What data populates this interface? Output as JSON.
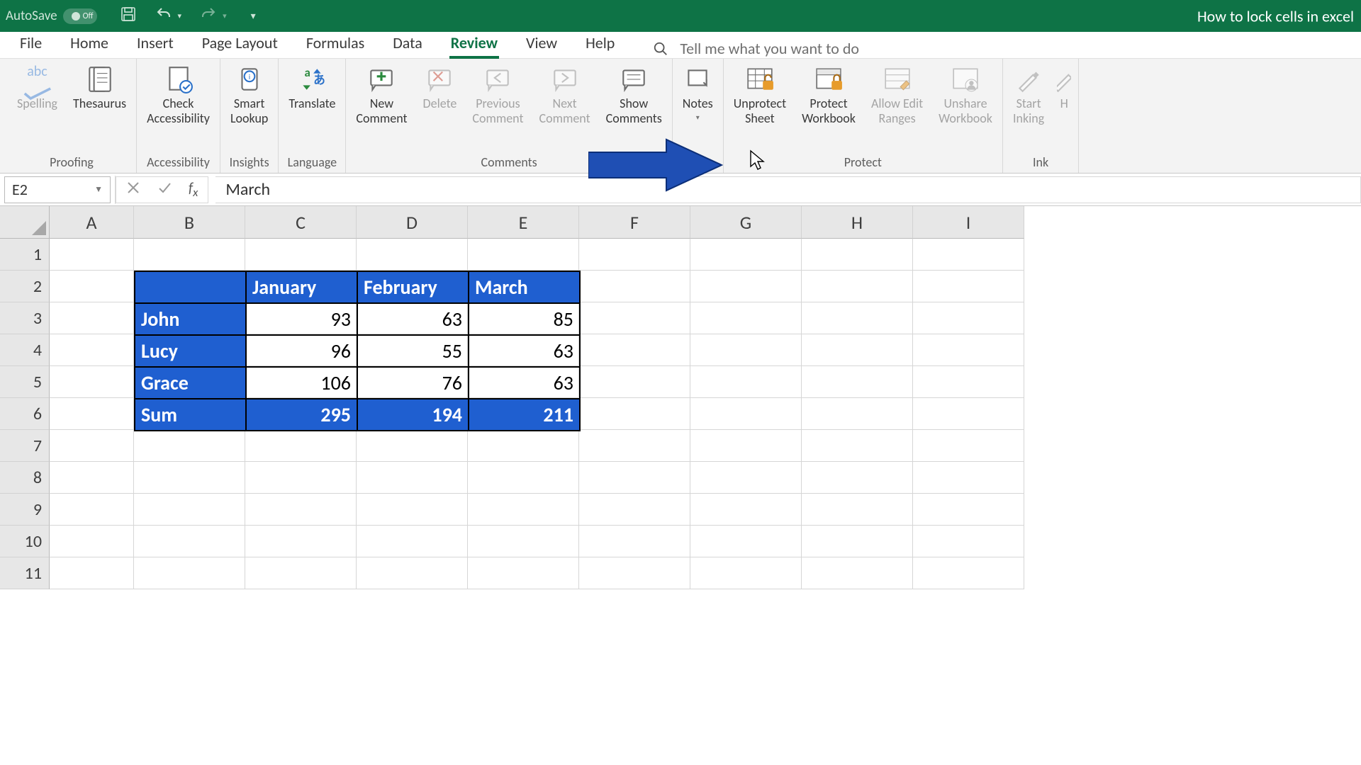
{
  "titlebar": {
    "autosave_label": "AutoSave",
    "autosave_state": "Off",
    "document_title": "How to lock cells in excel"
  },
  "tabs": {
    "file": "File",
    "home": "Home",
    "insert": "Insert",
    "page_layout": "Page Layout",
    "formulas": "Formulas",
    "data": "Data",
    "review": "Review",
    "view": "View",
    "help": "Help",
    "search_placeholder": "Tell me what you want to do"
  },
  "ribbon": {
    "proofing": {
      "spelling": "Spelling",
      "thesaurus": "Thesaurus",
      "label": "Proofing"
    },
    "accessibility": {
      "check": "Check\nAccessibility",
      "label": "Accessibility"
    },
    "insights": {
      "smart": "Smart\nLookup",
      "label": "Insights"
    },
    "language": {
      "translate": "Translate",
      "label": "Language"
    },
    "comments": {
      "new": "New\nComment",
      "delete": "Delete",
      "previous": "Previous\nComment",
      "next": "Next\nComment",
      "show": "Show\nComments",
      "label": "Comments"
    },
    "notes": {
      "notes": "Notes",
      "label": "Notes"
    },
    "protect": {
      "unprotect": "Unprotect\nSheet",
      "workbook": "Protect\nWorkbook",
      "ranges": "Allow Edit\nRanges",
      "unshare": "Unshare\nWorkbook",
      "label": "Protect"
    },
    "ink": {
      "start": "Start\nInking",
      "hide": "H",
      "label": "Ink"
    }
  },
  "formula_bar": {
    "name_box": "E2",
    "formula": "March"
  },
  "grid": {
    "columns": [
      "A",
      "B",
      "C",
      "D",
      "E",
      "F",
      "G",
      "H",
      "I"
    ],
    "rows": [
      "1",
      "2",
      "3",
      "4",
      "5",
      "6",
      "7",
      "8",
      "9",
      "10",
      "11"
    ]
  },
  "chart_data": {
    "type": "table",
    "corner": "",
    "columns": [
      "January",
      "February",
      "March"
    ],
    "rows": [
      "John",
      "Lucy",
      "Grace"
    ],
    "values": [
      [
        93,
        63,
        85
      ],
      [
        96,
        55,
        63
      ],
      [
        106,
        76,
        63
      ]
    ],
    "sum_label": "Sum",
    "sums": [
      295,
      194,
      211
    ]
  }
}
